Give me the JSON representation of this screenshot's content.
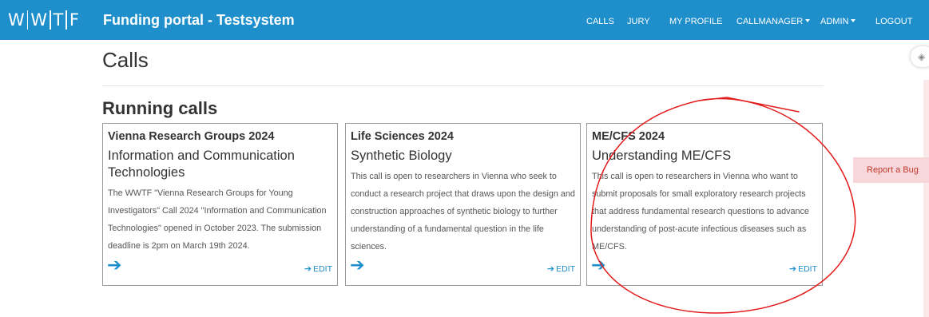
{
  "logo": {
    "letters": [
      "W",
      "W",
      "T",
      "F"
    ]
  },
  "header": {
    "brand": "Funding portal - Testsystem"
  },
  "nav": {
    "calls": "CALLS",
    "jury": "JURY",
    "my_profile": "MY PROFILE",
    "callmanager": "CALLMANAGER",
    "admin": "ADMIN",
    "logout": "LOGOUT"
  },
  "page": {
    "title": "Calls",
    "section_title": "Running calls"
  },
  "cards": [
    {
      "title": "Vienna Research Groups 2024",
      "subtitle": "Information and Communication Technologies",
      "description": "The WWTF \"Vienna Research Groups for Young Investigators\" Call 2024 \"Information and Communication Technologies\" opened in October 2023. The submission deadline is 2pm on March 19th 2024.",
      "edit_label": "EDIT"
    },
    {
      "title": "Life Sciences 2024",
      "subtitle": "Synthetic Biology",
      "description": "This call is open to researchers in Vienna who seek to conduct a research project that draws upon the design and construction approaches of synthetic biology to further understanding of a fundamental question in the life sciences.",
      "edit_label": "EDIT"
    },
    {
      "title": "ME/CFS 2024",
      "subtitle": "Understanding ME/CFS",
      "description": "This call is open to researchers in Vienna who want to submit proposals for small exploratory research projects that address fundamental research questions to advance understanding of post-acute infectious diseases such as ME/CFS.",
      "edit_label": "EDIT"
    }
  ],
  "report_bug": "Report a Bug",
  "colors": {
    "navbar": "#1f8fcc",
    "link": "#1f8fcc",
    "report_bug_bg": "#f8d7da",
    "report_bug_text": "#c0392b",
    "annotation": "#e31b1b"
  },
  "icons": {
    "card_open": "arrow-right-icon",
    "card_edit": "arrow-right-icon",
    "side_widget": "layers-icon"
  }
}
